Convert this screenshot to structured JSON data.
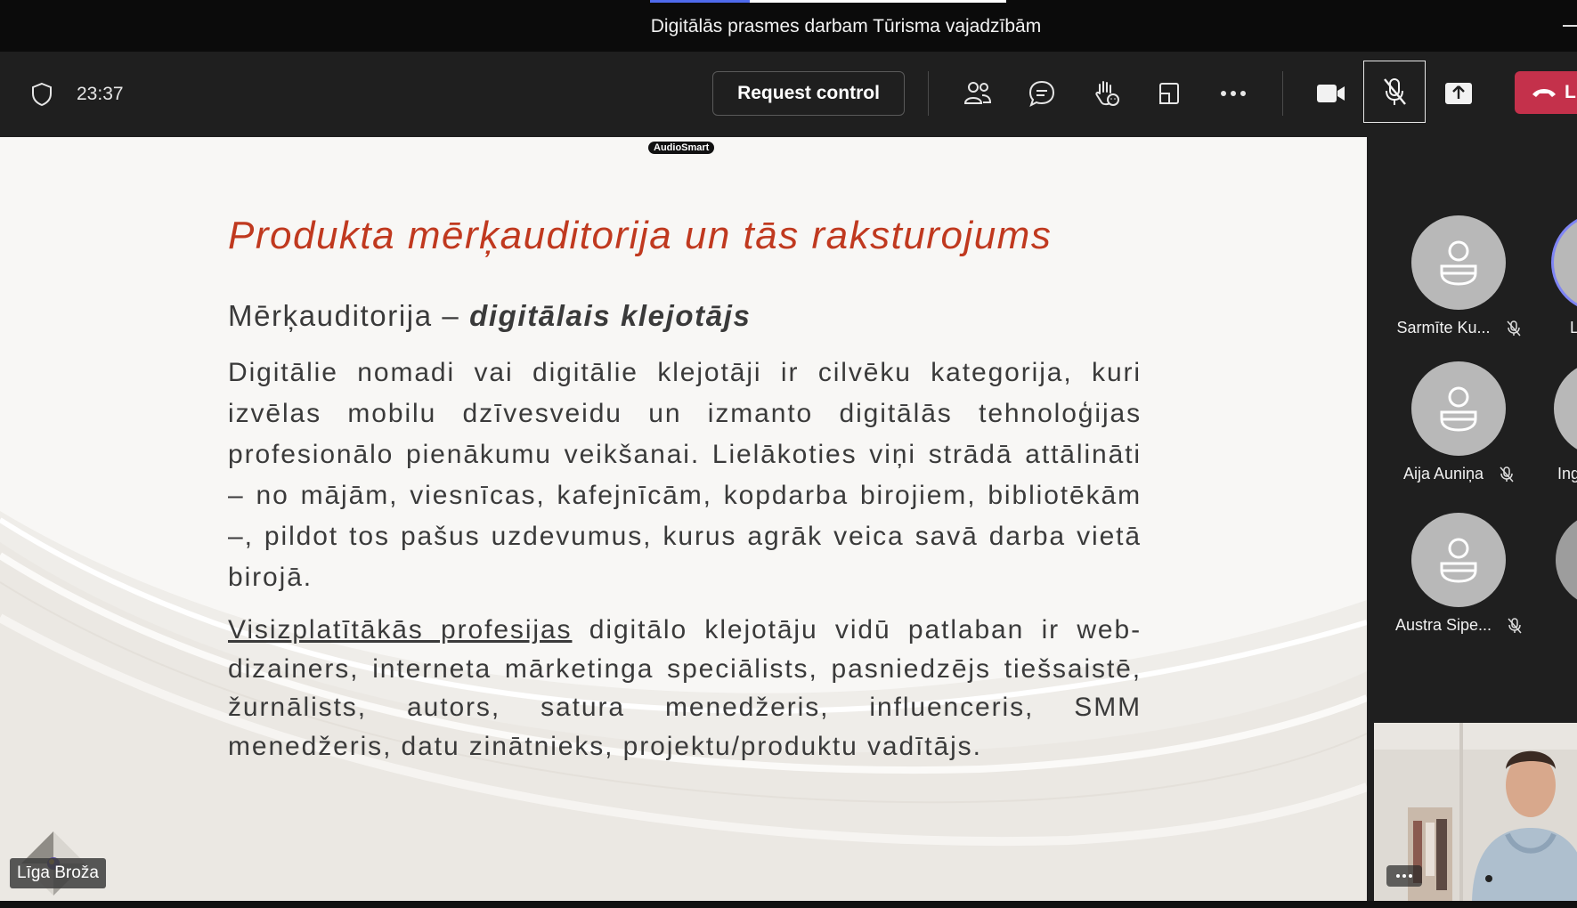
{
  "window": {
    "title": "Digitālās prasmes darbam Tūrisma vajadzībām"
  },
  "toolbar": {
    "meeting_time": "23:37",
    "request_control_label": "Request control",
    "leave_label": "L",
    "icons": [
      "shield-icon",
      "people-icon",
      "chat-icon",
      "raise-hand-icon",
      "view-icon",
      "more-icon",
      "camera-icon",
      "mic-muted-icon",
      "share-icon",
      "hang-up-icon"
    ],
    "leave_color": "#c4314b"
  },
  "slide": {
    "badge": "AudioSmart",
    "title": "Produkta mērķauditorija un tās raksturojums",
    "subtitle_prefix": "Mērķauditorija – ",
    "subtitle_emphasis": "digitālais klejotājs",
    "paragraph1": "Digitālie nomadi vai digitālie klejotāji ir cilvēku kategorija, kuri izvēlas mobilu dzīvesveidu un izmanto digitālās tehnoloģijas profesionālo pienākumu veikšanai. Lielākoties viņi strādā attālināti – no mājām, viesnīcas, kafejnīcām, kopdarba birojiem, bibliotēkām –, pildot tos pašus uzdevumus, kurus agrāk veica savā darba vietā birojā.",
    "paragraph2_link": "Visizplatītākās profesijas",
    "paragraph2_rest": " digitālo klejotāju vidū patlaban ir web-dizainers, interneta mārketinga speciālists, pasniedzējs tiešsaistē, žurnālists, autors, satura menedžeris, influenceris, SMM menedžeris, datu zinātnieks, projektu/produktu vadītājs.",
    "title_color": "#c0391f",
    "presenter_name": "Līga Broža"
  },
  "participants": [
    {
      "name": "Sarmīte Ku...",
      "muted": true
    },
    {
      "name": "Aija Auniņa",
      "muted": true
    },
    {
      "name": "Austra Sipe...",
      "muted": true
    }
  ],
  "partial_participants": [
    {
      "name": "L"
    },
    {
      "name": "Ing"
    }
  ]
}
